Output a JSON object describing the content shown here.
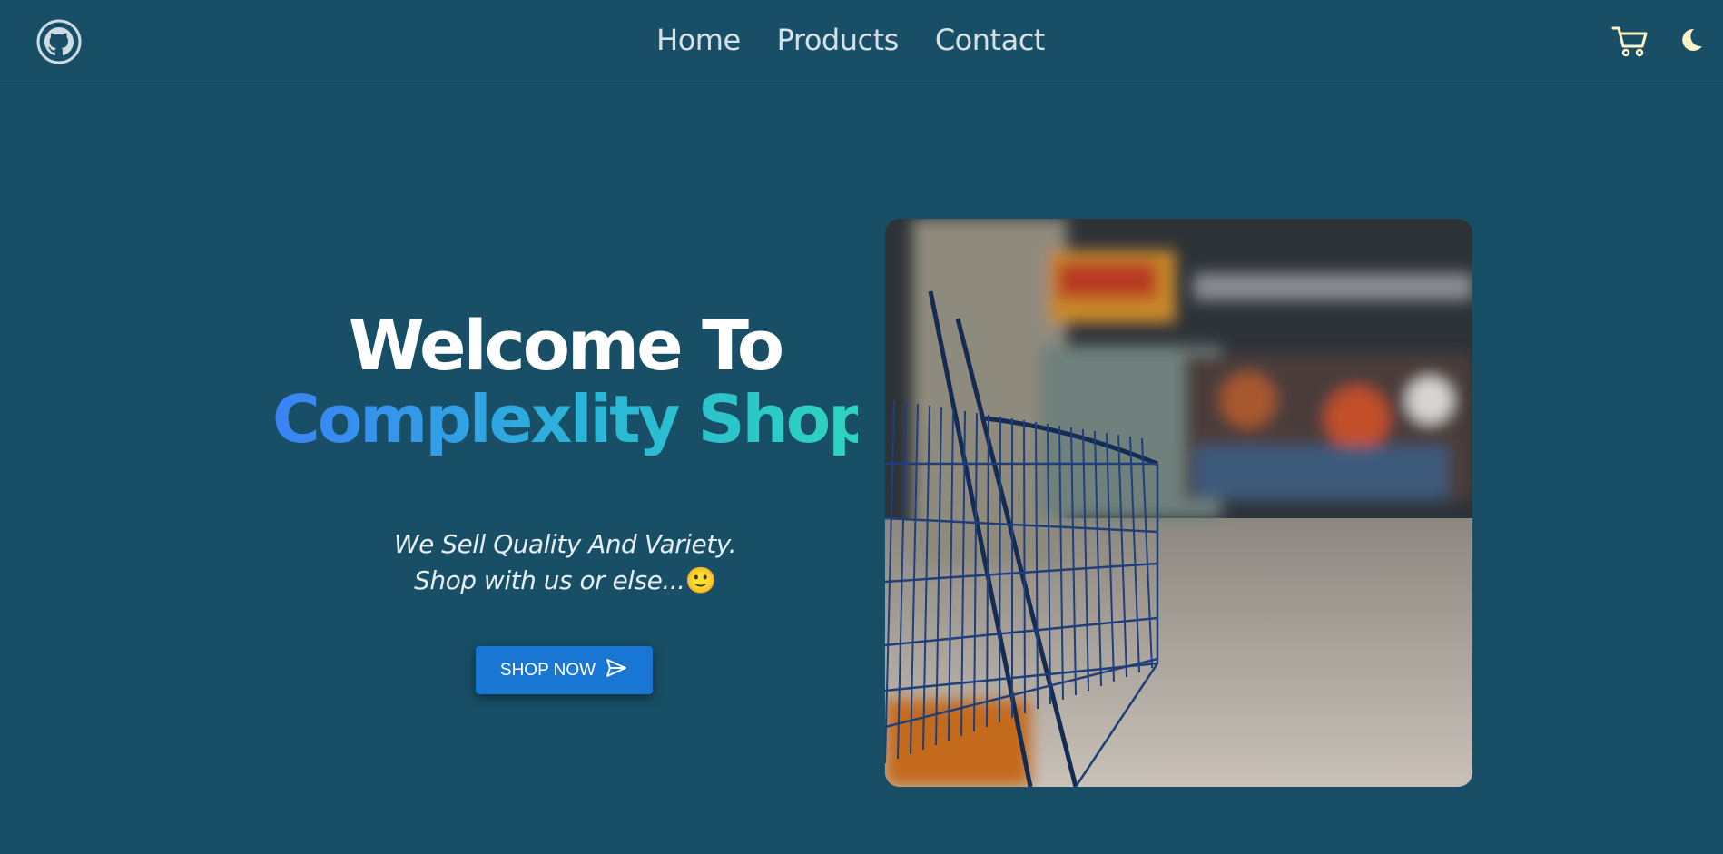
{
  "nav": {
    "logo_icon": "github-icon",
    "links": [
      {
        "label": "Home"
      },
      {
        "label": "Products"
      },
      {
        "label": "Contact"
      }
    ],
    "cart_icon": "cart-icon",
    "theme_icon": "moon-icon"
  },
  "hero": {
    "title_line1": "Welcome To",
    "title_line2": "Complexlity Shop",
    "tagline_line1": "We Sell Quality And Variety.",
    "tagline_line2": "Shop with us or else...",
    "tagline_emoji": "🙂",
    "cta_label": "SHOP NOW",
    "cta_icon": "send-icon",
    "image_alt": "shopping cart in supermarket aisle"
  },
  "colors": {
    "background": "#184f66",
    "accent_button": "#1976d2",
    "gradient_start": "#3b82f6",
    "gradient_end": "#2dd4bf",
    "moon": "#fef3c7"
  }
}
